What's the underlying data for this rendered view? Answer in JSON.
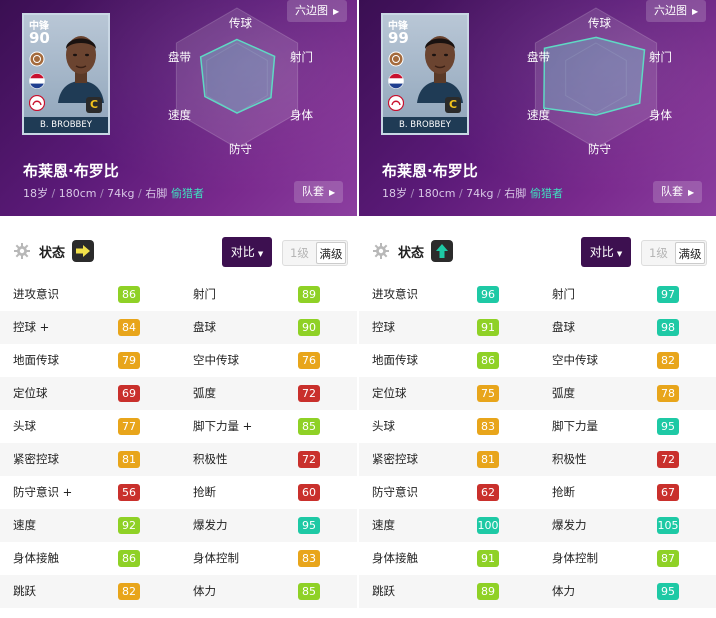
{
  "panels": [
    {
      "card": {
        "position": "中锋",
        "rating": "90",
        "name": "B. BROBBEY",
        "card_class": "C"
      },
      "player": {
        "name": "布莱恩·布罗比",
        "age": "18岁",
        "height": "180cm",
        "weight": "74kg",
        "foot": "右脚",
        "separator": " / ",
        "role": "偷猎者"
      },
      "buttons": {
        "hexagon": "六边图",
        "team": "队套",
        "compare": "对比"
      },
      "radar_labels": {
        "shoot": "射门",
        "pass": "传球",
        "dribble": "盘带",
        "speed": "速度",
        "defend": "防守",
        "physical": "身体"
      },
      "radar_values": {
        "pass": 0.55,
        "shoot": 0.62,
        "physical": 0.56,
        "defend": 0.5,
        "speed": 0.53,
        "dribble": 0.6
      },
      "status": {
        "label": "状态",
        "trend": "right-arrow-icon",
        "trend_color": "#f2e14b"
      },
      "level": {
        "lv1": "1级",
        "max": "满级"
      },
      "stats": [
        [
          "进攻意识",
          "86",
          "#8fd126",
          "射门",
          "89",
          "#8fd126"
        ],
        [
          "控球 +",
          "84",
          "#e8a51b",
          "盘球",
          "90",
          "#8fd126"
        ],
        [
          "地面传球",
          "79",
          "#e8a51b",
          "空中传球",
          "76",
          "#e8a51b"
        ],
        [
          "定位球",
          "69",
          "#c9302c",
          "弧度",
          "72",
          "#c9302c"
        ],
        [
          "头球",
          "77",
          "#e8a51b",
          "脚下力量 +",
          "85",
          "#8fd126"
        ],
        [
          "紧密控球",
          "81",
          "#e8a51b",
          "积极性",
          "72",
          "#c9302c"
        ],
        [
          "防守意识 +",
          "56",
          "#c9302c",
          "抢断",
          "60",
          "#c9302c"
        ],
        [
          "速度",
          "92",
          "#8fd126",
          "爆发力",
          "95",
          "#1ec9a5"
        ],
        [
          "身体接触",
          "86",
          "#8fd126",
          "身体控制",
          "83",
          "#e8a51b"
        ],
        [
          "跳跃",
          "82",
          "#e8a51b",
          "体力",
          "85",
          "#8fd126"
        ]
      ]
    },
    {
      "card": {
        "position": "中锋",
        "rating": "99",
        "name": "B. BROBBEY",
        "card_class": "C"
      },
      "player": {
        "name": "布莱恩·布罗比",
        "age": "18岁",
        "height": "180cm",
        "weight": "74kg",
        "foot": "右脚",
        "separator": " / ",
        "role": "偷猎者"
      },
      "buttons": {
        "hexagon": "六边图",
        "team": "队套",
        "compare": "对比"
      },
      "radar_labels": {
        "shoot": "射门",
        "pass": "传球",
        "dribble": "盘带",
        "speed": "速度",
        "defend": "防守",
        "physical": "身体"
      },
      "radar_values": {
        "pass": 0.58,
        "shoot": 0.8,
        "physical": 0.72,
        "defend": 0.53,
        "speed": 0.86,
        "dribble": 0.85
      },
      "status": {
        "label": "状态",
        "trend": "up-arrow-icon",
        "trend_color": "#1ec9a5"
      },
      "level": {
        "lv1": "1级",
        "max": "满级"
      },
      "stats": [
        [
          "进攻意识",
          "96",
          "#1ec9a5",
          "射门",
          "97",
          "#1ec9a5"
        ],
        [
          "控球",
          "91",
          "#8fd126",
          "盘球",
          "98",
          "#1ec9a5"
        ],
        [
          "地面传球",
          "86",
          "#8fd126",
          "空中传球",
          "82",
          "#e8a51b"
        ],
        [
          "定位球",
          "75",
          "#e8a51b",
          "弧度",
          "78",
          "#e8a51b"
        ],
        [
          "头球",
          "83",
          "#e8a51b",
          "脚下力量",
          "95",
          "#1ec9a5"
        ],
        [
          "紧密控球",
          "81",
          "#e8a51b",
          "积极性",
          "72",
          "#c9302c"
        ],
        [
          "防守意识",
          "62",
          "#c9302c",
          "抢断",
          "67",
          "#c9302c"
        ],
        [
          "速度",
          "100",
          "#1ec9a5",
          "爆发力",
          "105",
          "#1ec9a5"
        ],
        [
          "身体接触",
          "91",
          "#8fd126",
          "身体控制",
          "87",
          "#8fd126"
        ],
        [
          "跳跃",
          "89",
          "#8fd126",
          "体力",
          "95",
          "#1ec9a5"
        ]
      ]
    }
  ]
}
